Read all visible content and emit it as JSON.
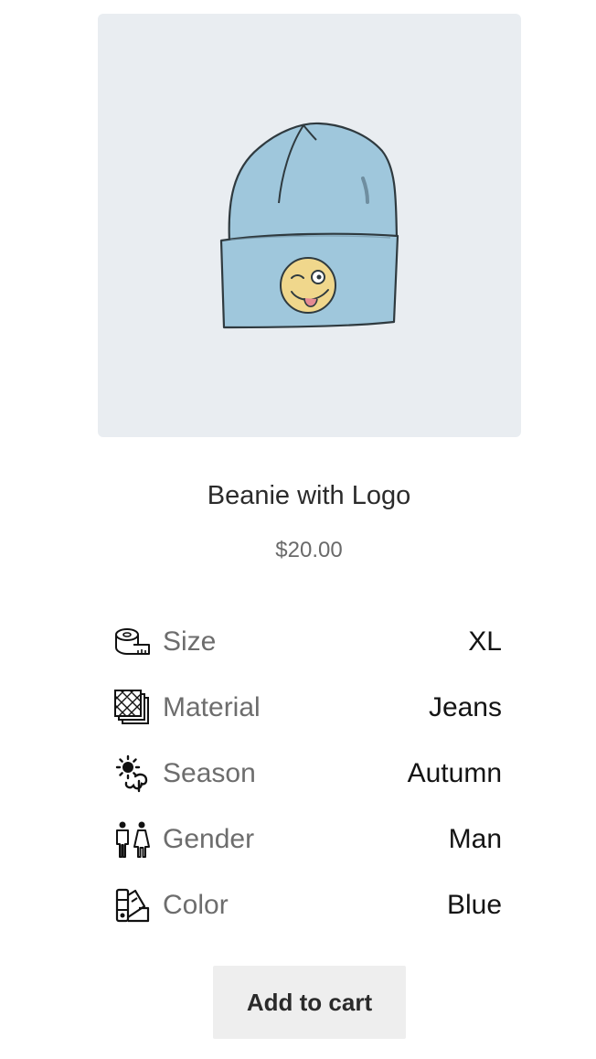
{
  "product": {
    "title": "Beanie with Logo",
    "price": "$20.00",
    "image_alt": "Beanie with Logo",
    "image_background": "#e9edf1",
    "beanie_color": "#9bc3d8",
    "logo_color": "#f1d98b"
  },
  "attributes": [
    {
      "icon": "measuring-tape-icon",
      "label": "Size",
      "value": "XL"
    },
    {
      "icon": "fabric-swatch-icon",
      "label": "Material",
      "value": "Jeans"
    },
    {
      "icon": "season-icon",
      "label": "Season",
      "value": "Autumn"
    },
    {
      "icon": "gender-icon",
      "label": "Gender",
      "value": "Man"
    },
    {
      "icon": "color-palette-icon",
      "label": "Color",
      "value": "Blue"
    }
  ],
  "cart": {
    "add_label": "Add to cart"
  }
}
